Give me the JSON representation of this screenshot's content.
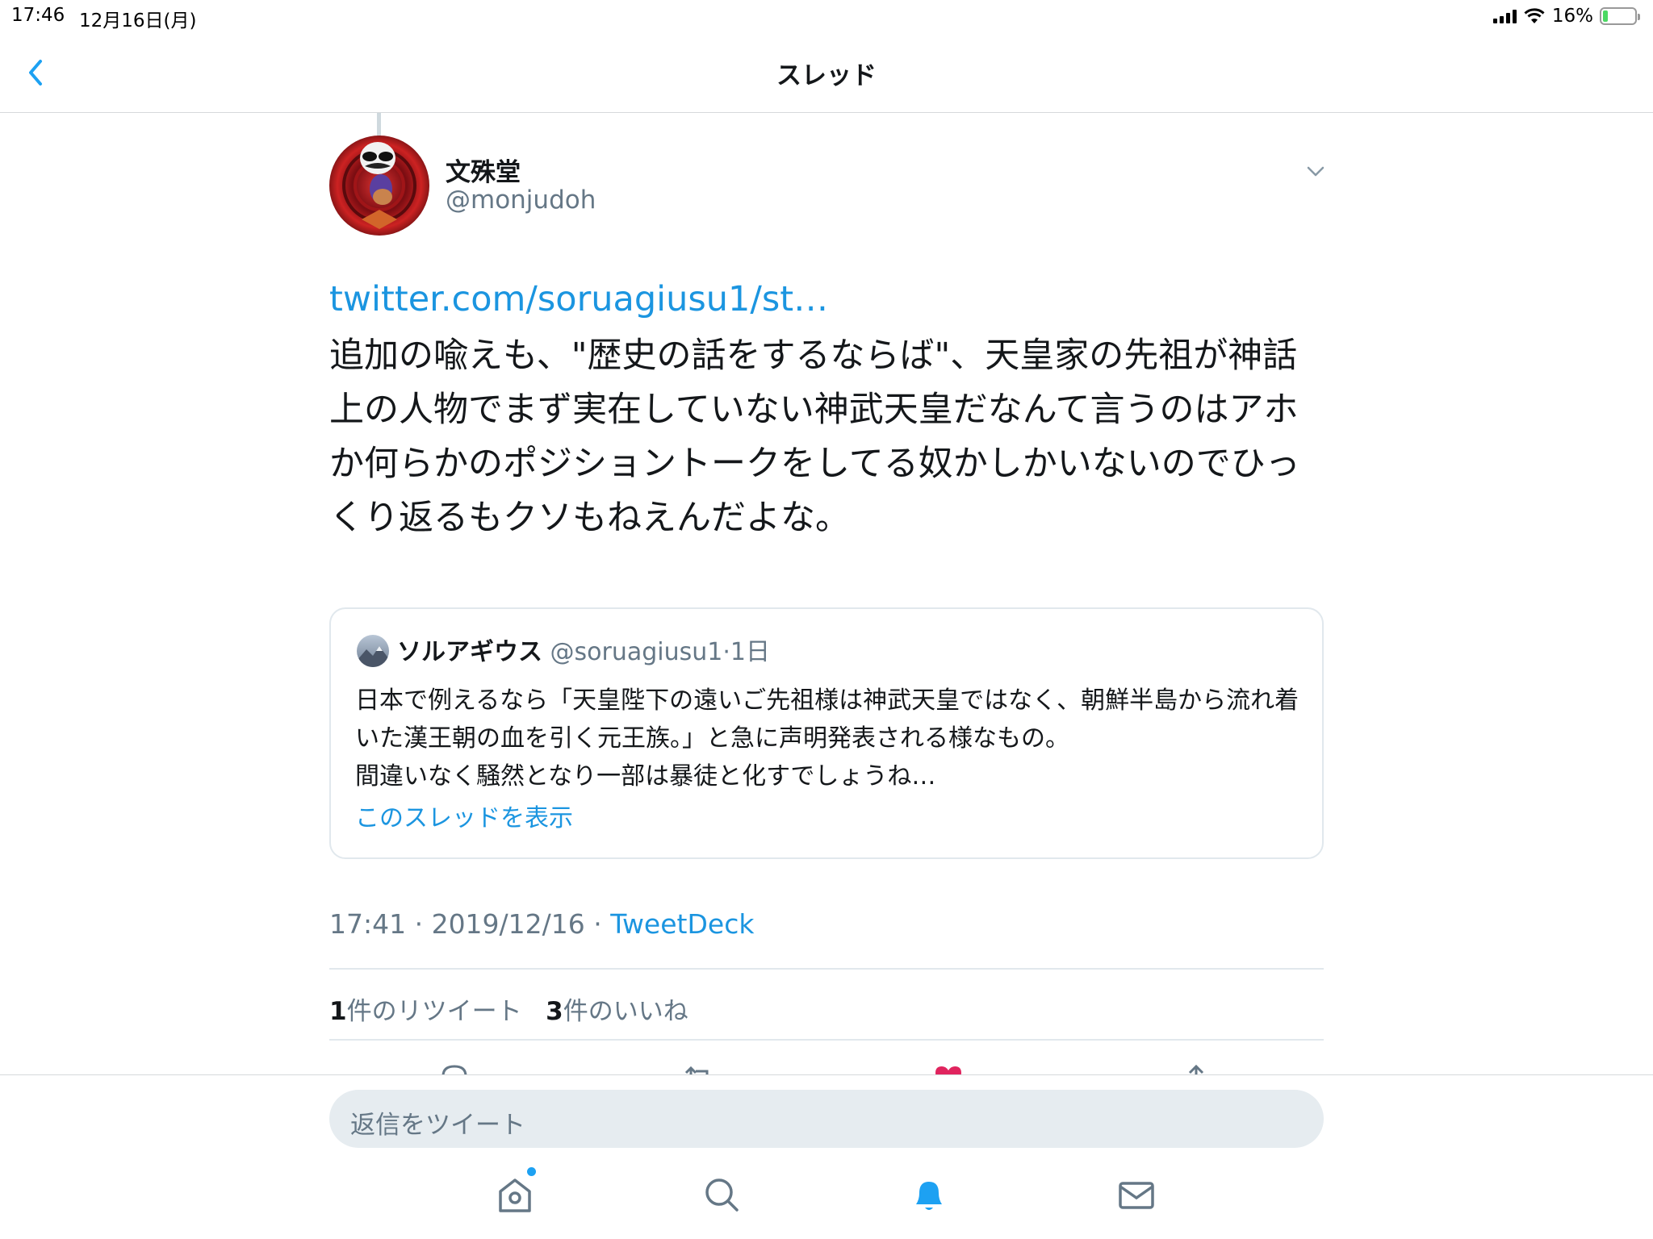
{
  "status_bar": {
    "time": "17:46",
    "date": "12月16日(月)",
    "battery": "16%",
    "battery_level": 0.16
  },
  "nav": {
    "title": "スレッド"
  },
  "tweet": {
    "author_name": "文殊堂",
    "author_handle": "@monjudoh",
    "link": "twitter.com/soruagiusu1/st…",
    "text": "追加の喩えも、\"歴史の話をするならば\"、天皇家の先祖が神話上の人物でまず実在していない神武天皇だなんて言うのはアホか何らかのポジショントークをしてる奴かしかいないのでひっくり返るもクソもねえんだよな。",
    "timestamp": "17:41 · 2019/12/16 · ",
    "client": "TweetDeck",
    "retweet_count": "1",
    "retweet_label": "件のリツイート",
    "like_count": "3",
    "like_label": "件のいいね"
  },
  "quoted_tweet": {
    "name": "ソルアギウス",
    "handle_time": " @soruagiusu1·1日",
    "text": "日本で例えるなら「天皇陛下の遠いご先祖様は神武天皇ではなく、朝鮮半島から流れ着いた漢王朝の血を引く元王族。」と急に声明発表される様なもの。\n間違いなく騒然となり一部は暴徒と化すでしょうね…",
    "show_thread": "このスレッドを表示"
  },
  "reply": {
    "placeholder": "返信をツイート"
  },
  "colors": {
    "accent": "#1b95e0",
    "secondary_text": "#657786",
    "like": "#e0245e",
    "border": "#e1e8ed"
  },
  "icons": {
    "back": "chevron-left-icon",
    "caret": "chevron-down-icon",
    "reply": "reply-icon",
    "retweet": "retweet-icon",
    "like": "heart-icon",
    "share": "share-icon",
    "home": "home-icon",
    "search": "search-icon",
    "notifications": "bell-icon",
    "messages": "mail-icon"
  }
}
